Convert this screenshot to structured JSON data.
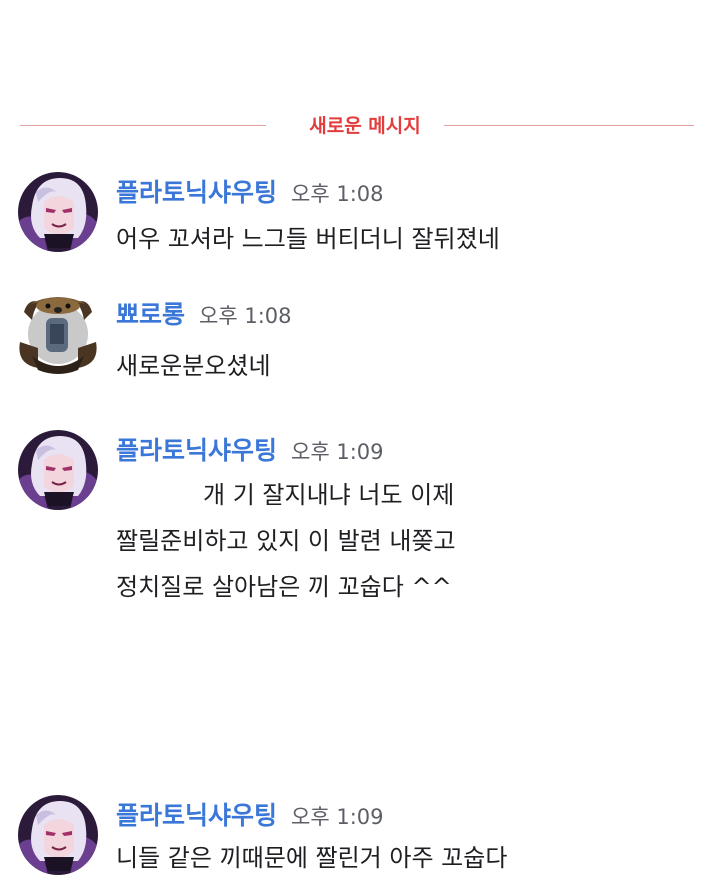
{
  "divider": {
    "label": "새로운 메시지",
    "color": "#e23c3c"
  },
  "messages": [
    {
      "user": "플라토닉샤우팅",
      "time": "오후 1:08",
      "avatar_icon": "anime-girl-avatar-icon",
      "lines": [
        "어우 꼬셔라 느그들 버티더니 잘뒤졌네"
      ]
    },
    {
      "user": "뾰로롱",
      "time": "오후 1:08",
      "avatar_icon": "dog-figure-avatar-icon",
      "lines": [
        "새로운분오셨네"
      ]
    },
    {
      "user": "플라토닉샤우팅",
      "time": "오후 1:09",
      "avatar_icon": "anime-girl-avatar-icon",
      "lines": [
        "개  기 잘지내냐 너도 이제",
        "짤릴준비하고 있지 이  발련          내쫒고",
        "정치질로 살아남은   끼 꼬숩다 ^^"
      ]
    },
    {
      "user": "플라토닉샤우팅",
      "time": "오후 1:09",
      "avatar_icon": "anime-girl-avatar-icon",
      "lines": [
        "니들  같은   끼때문에 짤린거 아주 꼬숩다"
      ]
    }
  ],
  "colors": {
    "username": "#3a77d8",
    "timestamp": "#5c5e66",
    "text": "#1e1f22",
    "divider": "#e23c3c"
  }
}
